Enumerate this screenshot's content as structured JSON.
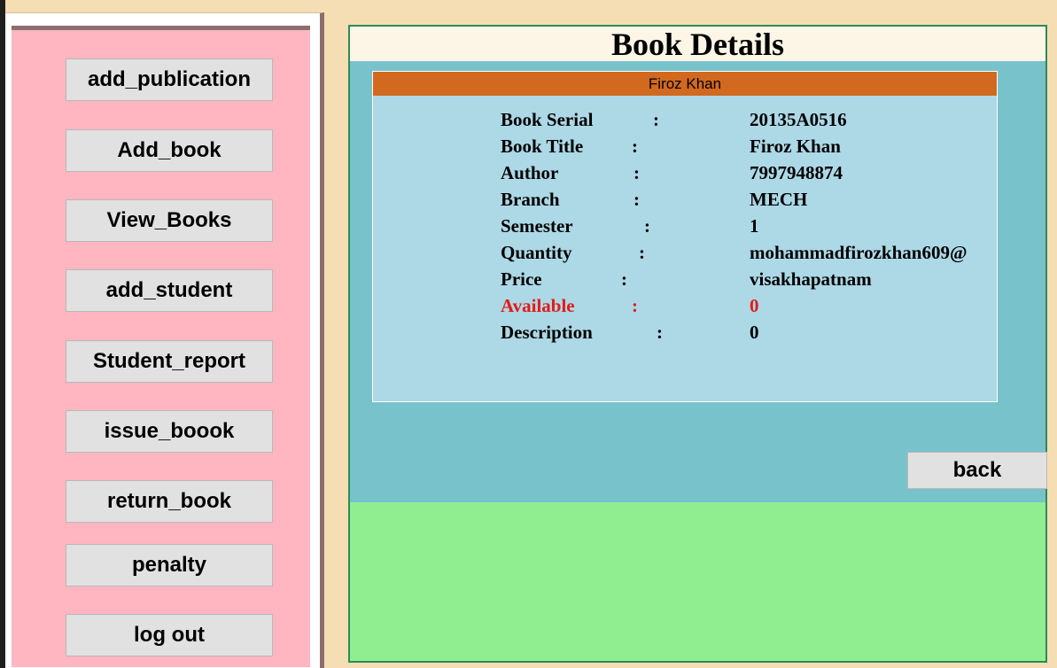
{
  "sidebar": {
    "buttons": [
      {
        "label": "add_publication"
      },
      {
        "label": "Add_book"
      },
      {
        "label": "View_Books"
      },
      {
        "label": "add_student"
      },
      {
        "label": "Student_report"
      },
      {
        "label": "issue_boook"
      },
      {
        "label": "return_book"
      },
      {
        "label": "penalty"
      },
      {
        "label": "log out"
      }
    ]
  },
  "main": {
    "title": "Book Details",
    "card": {
      "header": "Firoz Khan",
      "rows": [
        {
          "label": "Book Serial",
          "colon": ":",
          "value": "20135A0516"
        },
        {
          "label": "Book Title",
          "colon": ":",
          "value": "Firoz Khan"
        },
        {
          "label": "Author",
          "colon": ":",
          "value": "7997948874"
        },
        {
          "label": "Branch",
          "colon": ":",
          "value": "MECH"
        },
        {
          "label": "Semester",
          "colon": ":",
          "value": "1"
        },
        {
          "label": "Quantity",
          "colon": ":",
          "value": "mohammadfirozkhan609@"
        },
        {
          "label": "Price",
          "colon": ":",
          "value": "visakhapatnam"
        },
        {
          "label": "Available",
          "colon": ":",
          "value": "0"
        },
        {
          "label": "Description",
          "colon": ":",
          "value": "0"
        }
      ]
    },
    "back_label": "back"
  },
  "colors": {
    "page_bg": "#f5deb3",
    "sidebar_bg": "#ffb6c1",
    "title_bg": "#fdf5e6",
    "teal_bg": "#78c2cc",
    "card_bg": "#add8e6",
    "card_header_bg": "#d2691e",
    "bottom_bg": "#90ee90",
    "available_red": "#e31b1b"
  }
}
